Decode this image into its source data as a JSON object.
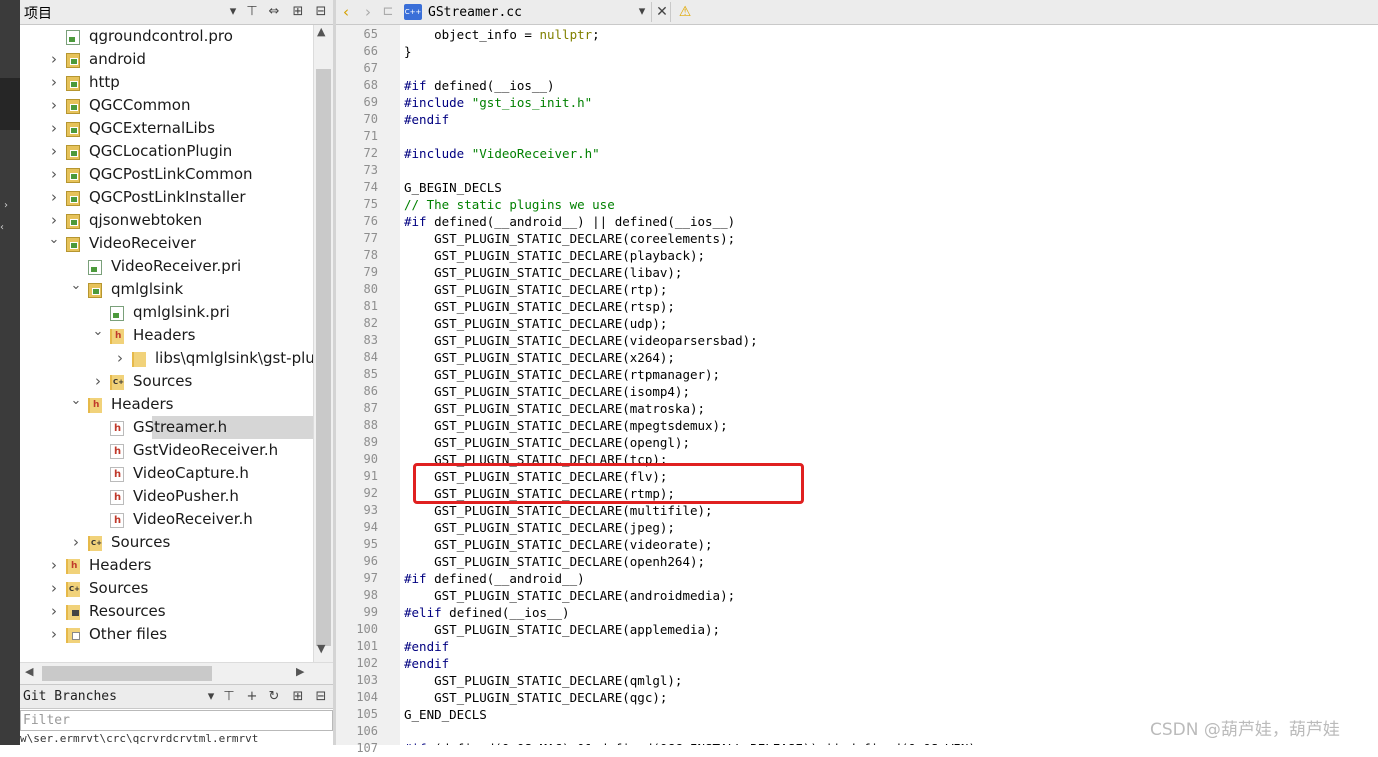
{
  "project_panel": {
    "title": "项目",
    "tree": [
      {
        "label": "qgroundcontrol.pro",
        "icon": "pro-file-icon",
        "expand": "",
        "depth": 1
      },
      {
        "label": "android",
        "icon": "qt-folder-icon",
        "expand": "›",
        "depth": 1
      },
      {
        "label": "http",
        "icon": "qt-folder-icon",
        "expand": "›",
        "depth": 1
      },
      {
        "label": "QGCCommon",
        "icon": "qt-folder-icon",
        "expand": "›",
        "depth": 1
      },
      {
        "label": "QGCExternalLibs",
        "icon": "qt-folder-icon",
        "expand": "›",
        "depth": 1
      },
      {
        "label": "QGCLocationPlugin",
        "icon": "qt-folder-icon",
        "expand": "›",
        "depth": 1
      },
      {
        "label": "QGCPostLinkCommon",
        "icon": "qt-folder-icon",
        "expand": "›",
        "depth": 1
      },
      {
        "label": "QGCPostLinkInstaller",
        "icon": "qt-folder-icon",
        "expand": "›",
        "depth": 1
      },
      {
        "label": "qjsonwebtoken",
        "icon": "qt-folder-icon",
        "expand": "›",
        "depth": 1
      },
      {
        "label": "VideoReceiver",
        "icon": "qt-folder-icon",
        "expand": "⌄",
        "depth": 1
      },
      {
        "label": "VideoReceiver.pri",
        "icon": "pro-file-icon",
        "expand": "",
        "depth": 2
      },
      {
        "label": "qmlglsink",
        "icon": "qt-folder-icon",
        "expand": "⌄",
        "depth": 2
      },
      {
        "label": "qmlglsink.pri",
        "icon": "pro-file-icon",
        "expand": "",
        "depth": 3
      },
      {
        "label": "Headers",
        "icon": "headers-folder-icon",
        "expand": "⌄",
        "depth": 3
      },
      {
        "label": "libs\\qmlglsink\\gst-plu",
        "icon": "folder-icon",
        "expand": "›",
        "depth": 4
      },
      {
        "label": "Sources",
        "icon": "sources-folder-icon",
        "expand": "›",
        "depth": 3
      },
      {
        "label": "Headers",
        "icon": "headers-folder-icon",
        "expand": "⌄",
        "depth": 2
      },
      {
        "label": "GStreamer.h",
        "icon": "header-file-icon",
        "expand": "",
        "depth": 3,
        "selected": true
      },
      {
        "label": "GstVideoReceiver.h",
        "icon": "header-file-icon",
        "expand": "",
        "depth": 3
      },
      {
        "label": "VideoCapture.h",
        "icon": "header-file-icon",
        "expand": "",
        "depth": 3
      },
      {
        "label": "VideoPusher.h",
        "icon": "header-file-icon",
        "expand": "",
        "depth": 3
      },
      {
        "label": "VideoReceiver.h",
        "icon": "header-file-icon",
        "expand": "",
        "depth": 3
      },
      {
        "label": "Sources",
        "icon": "sources-folder-icon",
        "expand": "›",
        "depth": 2
      },
      {
        "label": "Headers",
        "icon": "headers-folder-icon",
        "expand": "›",
        "depth": 1
      },
      {
        "label": "Sources",
        "icon": "sources-folder-icon",
        "expand": "›",
        "depth": 1
      },
      {
        "label": "Resources",
        "icon": "resources-folder-icon",
        "expand": "›",
        "depth": 1
      },
      {
        "label": "Other files",
        "icon": "other-files-folder-icon",
        "expand": "›",
        "depth": 1
      }
    ]
  },
  "git_panel": {
    "title": "Git Branches",
    "filter_placeholder": "Filter",
    "path_text": "w\\ser.ermrvt\\crc\\qcrvrdcrvtml.ermrvt"
  },
  "editor": {
    "file_name": "GStreamer.cc",
    "lines": [
      {
        "n": "65",
        "tokens": [
          {
            "t": "    object_info = ",
            "c": "def"
          },
          {
            "t": "nullptr",
            "c": "kw"
          },
          {
            "t": ";",
            "c": "def"
          }
        ]
      },
      {
        "n": "66",
        "tokens": [
          {
            "t": "}",
            "c": "def"
          }
        ]
      },
      {
        "n": "67",
        "tokens": []
      },
      {
        "n": "68",
        "tokens": [
          {
            "t": "#if",
            "c": "pp"
          },
          {
            "t": " defined(__ios__)",
            "c": "def"
          }
        ]
      },
      {
        "n": "69",
        "tokens": [
          {
            "t": "#include",
            "c": "pp"
          },
          {
            "t": " ",
            "c": "def"
          },
          {
            "t": "\"gst_ios_init.h\"",
            "c": "str"
          }
        ]
      },
      {
        "n": "70",
        "tokens": [
          {
            "t": "#endif",
            "c": "pp"
          }
        ]
      },
      {
        "n": "71",
        "tokens": []
      },
      {
        "n": "72",
        "tokens": [
          {
            "t": "#include",
            "c": "pp"
          },
          {
            "t": " ",
            "c": "def"
          },
          {
            "t": "\"VideoReceiver.h\"",
            "c": "str"
          }
        ]
      },
      {
        "n": "73",
        "tokens": []
      },
      {
        "n": "74",
        "tokens": [
          {
            "t": "G_BEGIN_DECLS",
            "c": "def"
          }
        ]
      },
      {
        "n": "75",
        "tokens": [
          {
            "t": "// The static plugins we use",
            "c": "cm"
          }
        ]
      },
      {
        "n": "76",
        "tokens": [
          {
            "t": "#if",
            "c": "pp"
          },
          {
            "t": " defined(__android__) || defined(__ios__)",
            "c": "def"
          }
        ]
      },
      {
        "n": "77",
        "tokens": [
          {
            "t": "    GST_PLUGIN_STATIC_DECLARE(coreelements);",
            "c": "def"
          }
        ]
      },
      {
        "n": "78",
        "tokens": [
          {
            "t": "    GST_PLUGIN_STATIC_DECLARE(playback);",
            "c": "def"
          }
        ]
      },
      {
        "n": "79",
        "tokens": [
          {
            "t": "    GST_PLUGIN_STATIC_DECLARE(libav);",
            "c": "def"
          }
        ]
      },
      {
        "n": "80",
        "tokens": [
          {
            "t": "    GST_PLUGIN_STATIC_DECLARE(rtp);",
            "c": "def"
          }
        ]
      },
      {
        "n": "81",
        "tokens": [
          {
            "t": "    GST_PLUGIN_STATIC_DECLARE(rtsp);",
            "c": "def"
          }
        ]
      },
      {
        "n": "82",
        "tokens": [
          {
            "t": "    GST_PLUGIN_STATIC_DECLARE(udp);",
            "c": "def"
          }
        ]
      },
      {
        "n": "83",
        "tokens": [
          {
            "t": "    GST_PLUGIN_STATIC_DECLARE(videoparsersbad);",
            "c": "def"
          }
        ]
      },
      {
        "n": "84",
        "tokens": [
          {
            "t": "    GST_PLUGIN_STATIC_DECLARE(x264);",
            "c": "def"
          }
        ]
      },
      {
        "n": "85",
        "tokens": [
          {
            "t": "    GST_PLUGIN_STATIC_DECLARE(rtpmanager);",
            "c": "def"
          }
        ]
      },
      {
        "n": "86",
        "tokens": [
          {
            "t": "    GST_PLUGIN_STATIC_DECLARE(isomp4);",
            "c": "def"
          }
        ]
      },
      {
        "n": "87",
        "tokens": [
          {
            "t": "    GST_PLUGIN_STATIC_DECLARE(matroska);",
            "c": "def"
          }
        ]
      },
      {
        "n": "88",
        "tokens": [
          {
            "t": "    GST_PLUGIN_STATIC_DECLARE(mpegtsdemux);",
            "c": "def"
          }
        ]
      },
      {
        "n": "89",
        "tokens": [
          {
            "t": "    GST_PLUGIN_STATIC_DECLARE(opengl);",
            "c": "def"
          }
        ]
      },
      {
        "n": "90",
        "tokens": [
          {
            "t": "    GST_PLUGIN_STATIC_DECLARE(tcp);",
            "c": "def"
          }
        ]
      },
      {
        "n": "91",
        "tokens": [
          {
            "t": "    GST_PLUGIN_STATIC_DECLARE(flv);",
            "c": "def"
          }
        ]
      },
      {
        "n": "92",
        "tokens": [
          {
            "t": "    GST_PLUGIN_STATIC_DECLARE(rtmp);",
            "c": "def"
          }
        ]
      },
      {
        "n": "93",
        "tokens": [
          {
            "t": "    GST_PLUGIN_STATIC_DECLARE(multifile);",
            "c": "def"
          }
        ]
      },
      {
        "n": "94",
        "tokens": [
          {
            "t": "    GST_PLUGIN_STATIC_DECLARE(jpeg);",
            "c": "def"
          }
        ]
      },
      {
        "n": "95",
        "tokens": [
          {
            "t": "    GST_PLUGIN_STATIC_DECLARE(videorate);",
            "c": "def"
          }
        ]
      },
      {
        "n": "96",
        "tokens": [
          {
            "t": "    GST_PLUGIN_STATIC_DECLARE(openh264);",
            "c": "def"
          }
        ]
      },
      {
        "n": "97",
        "tokens": [
          {
            "t": "#if",
            "c": "pp"
          },
          {
            "t": " defined(__android__)",
            "c": "def"
          }
        ]
      },
      {
        "n": "98",
        "tokens": [
          {
            "t": "    GST_PLUGIN_STATIC_DECLARE(androidmedia);",
            "c": "def"
          }
        ]
      },
      {
        "n": "99",
        "tokens": [
          {
            "t": "#elif",
            "c": "pp"
          },
          {
            "t": " defined(__ios__)",
            "c": "def"
          }
        ]
      },
      {
        "n": "100",
        "tokens": [
          {
            "t": "    GST_PLUGIN_STATIC_DECLARE(applemedia);",
            "c": "def"
          }
        ]
      },
      {
        "n": "101",
        "tokens": [
          {
            "t": "#endif",
            "c": "pp"
          }
        ]
      },
      {
        "n": "102",
        "tokens": [
          {
            "t": "#endif",
            "c": "pp"
          }
        ]
      },
      {
        "n": "103",
        "tokens": [
          {
            "t": "    GST_PLUGIN_STATIC_DECLARE(qmlgl);",
            "c": "def"
          }
        ]
      },
      {
        "n": "104",
        "tokens": [
          {
            "t": "    GST_PLUGIN_STATIC_DECLARE(qgc);",
            "c": "def"
          }
        ]
      },
      {
        "n": "105",
        "tokens": [
          {
            "t": "G_END_DECLS",
            "c": "def"
          }
        ]
      },
      {
        "n": "106",
        "tokens": []
      },
      {
        "n": "107",
        "tokens": [
          {
            "t": "#if",
            "c": "pp"
          },
          {
            "t": " (defined(Q_OS_MAC) && defined(QGC_INSTALL_RELEASE)) || defined(Q_OS_WIN)",
            "c": "def"
          }
        ]
      }
    ]
  },
  "watermark": "CSDN @葫芦娃，葫芦娃",
  "colors": {
    "highlight_box": "#e02020",
    "preprocessor": "#000080",
    "string": "#008000",
    "keyword": "#808000",
    "comment": "#008000"
  }
}
